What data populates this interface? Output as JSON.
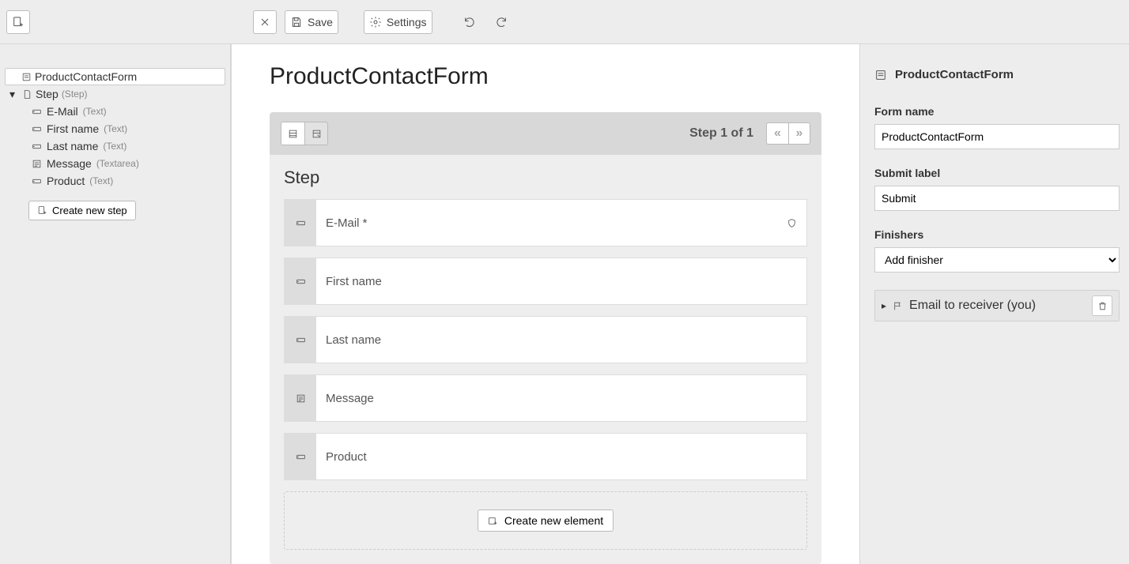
{
  "toolbar": {
    "save_label": "Save",
    "settings_label": "Settings"
  },
  "tree": {
    "root_label": "ProductContactForm",
    "step_label": "Step",
    "step_type": "(Step)",
    "items": [
      {
        "label": "E-Mail",
        "type": "(Text)"
      },
      {
        "label": "First name",
        "type": "(Text)"
      },
      {
        "label": "Last name",
        "type": "(Text)"
      },
      {
        "label": "Message",
        "type": "(Textarea)"
      },
      {
        "label": "Product",
        "type": "(Text)"
      }
    ],
    "create_step_label": "Create new step"
  },
  "editor": {
    "title": "ProductContactForm",
    "step_counter": "Step 1 of 1",
    "step_title": "Step",
    "fields": [
      {
        "label": "E-Mail *",
        "kind": "text",
        "shield": true
      },
      {
        "label": "First name",
        "kind": "text",
        "shield": false
      },
      {
        "label": "Last name",
        "kind": "text",
        "shield": false
      },
      {
        "label": "Message",
        "kind": "textarea",
        "shield": false
      },
      {
        "label": "Product",
        "kind": "text",
        "shield": false
      }
    ],
    "create_element_label": "Create new element"
  },
  "inspector": {
    "header": "ProductContactForm",
    "form_name_label": "Form name",
    "form_name_value": "ProductContactForm",
    "submit_label_label": "Submit label",
    "submit_label_value": "Submit",
    "finishers_label": "Finishers",
    "finishers_placeholder": "Add finisher",
    "finisher_item": "Email to receiver (you)"
  }
}
